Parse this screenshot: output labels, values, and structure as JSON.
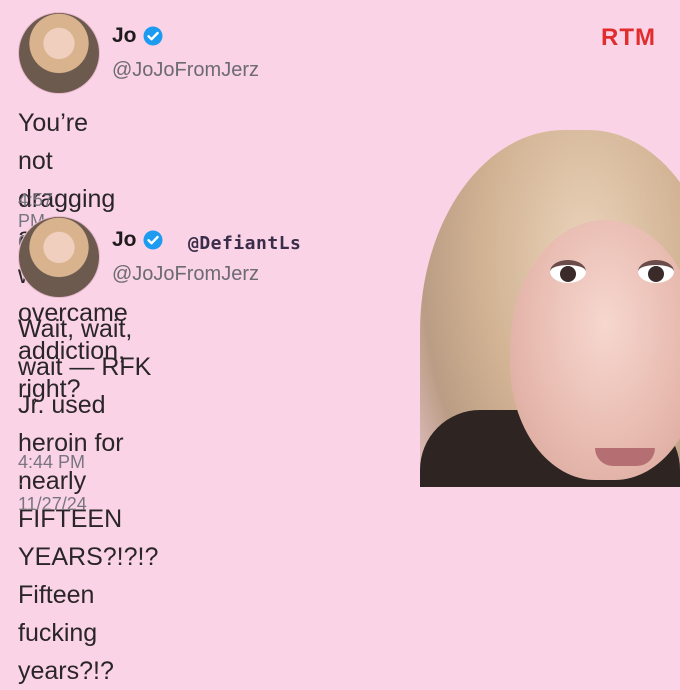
{
  "brand": {
    "logo": "RTM",
    "accent": "#e02d2d"
  },
  "tweets": [
    {
      "name": "Jo",
      "handle": "@JoJoFromJerz",
      "text": "You’re not dragging a guy who overcame\naddiction, right?",
      "time": "4:57 PM · 6/30/24"
    },
    {
      "name": "Jo",
      "handle": "@JoJoFromJerz",
      "text": "Wait, wait, wait — RFK Jr. used heroin for\nnearly FIFTEEN YEARS?!?!?\nFifteen fucking years?!?",
      "time": "4:44 PM · 11/27/24"
    }
  ],
  "watermark": "@DefiantLs",
  "icons": {
    "verified": "verified-badge-icon"
  },
  "colors": {
    "background": "#fad3e6",
    "verified": "#1d9bf0"
  }
}
